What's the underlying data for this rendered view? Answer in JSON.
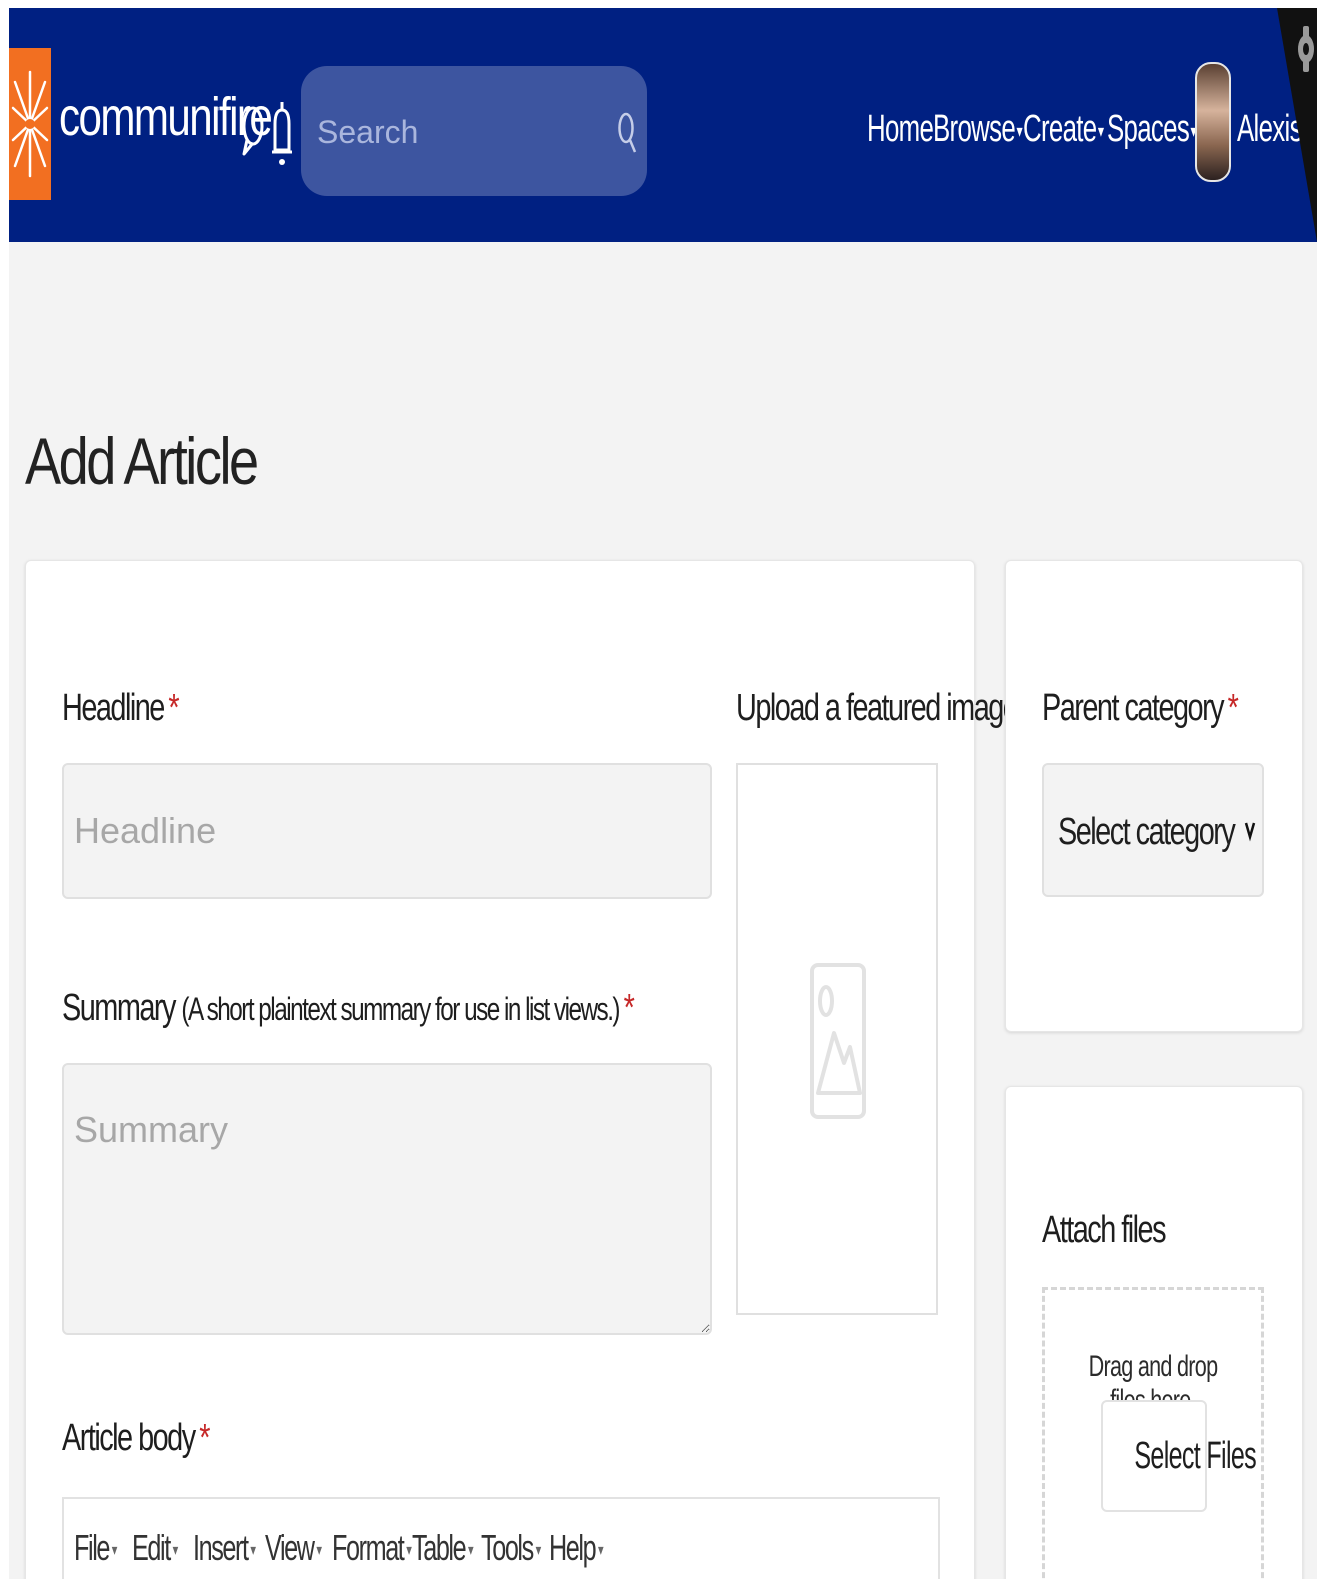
{
  "header": {
    "brand": "communifire",
    "brand_tm": "™",
    "search_placeholder": "Search",
    "nav": {
      "home": "Home",
      "browse": "Browse",
      "create": "Create",
      "spaces": "Spaces",
      "user": "Alexis"
    },
    "caret": "▾",
    "colors": {
      "bar": "#002082",
      "logo": "#f26f21",
      "search": "#3d55a0"
    }
  },
  "page": {
    "title": "Add Article"
  },
  "form": {
    "headline": {
      "label": "Headline",
      "required": "*",
      "placeholder": "Headline"
    },
    "summary": {
      "label": "Summary",
      "hint": "(A short plaintext summary for use in list views.)",
      "required": "*",
      "placeholder": "Summary"
    },
    "featured_image": {
      "label": "Upload a featured image",
      "icon": "image-placeholder-icon"
    },
    "article_body": {
      "label": "Article body",
      "required": "*",
      "menus": [
        "File",
        "Edit",
        "Insert",
        "View",
        "Format",
        "Table",
        "Tools",
        "Help"
      ]
    }
  },
  "sidebar": {
    "parent_category": {
      "label": "Parent category",
      "required": "*",
      "selected": "Select category"
    },
    "attach": {
      "title": "Attach files",
      "drop_text": "Drag and drop files here.",
      "button": "Select Files"
    }
  }
}
